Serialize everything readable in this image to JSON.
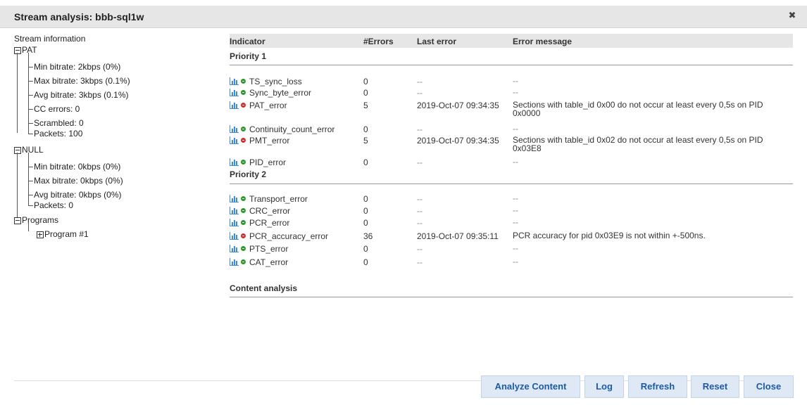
{
  "window": {
    "title": "Stream analysis: bbb-sql1w",
    "close_glyph": "✖"
  },
  "tree": {
    "root": "Stream information",
    "pat": {
      "label": "PAT",
      "items": [
        "Min bitrate: 2kbps (0%)",
        "Max bitrate: 3kbps (0.1%)",
        "Avg bitrate: 3kbps (0.1%)",
        "CC errors: 0",
        "Scrambled: 0",
        "Packets: 100"
      ]
    },
    "null": {
      "label": "NULL",
      "items": [
        "Min bitrate: 0kbps (0%)",
        "Max bitrate: 0kbps (0%)",
        "Avg bitrate: 0kbps (0%)",
        "Packets: 0"
      ]
    },
    "programs": {
      "label": "Programs",
      "items": [
        "Program #1"
      ]
    }
  },
  "table": {
    "headers": {
      "indicator": "Indicator",
      "errors": "#Errors",
      "last": "Last error",
      "message": "Error message"
    },
    "priority1": {
      "title": "Priority 1",
      "rows": [
        {
          "name": "TS_sync_loss",
          "status": "ok",
          "count": "0",
          "last": "--",
          "msg": "--"
        },
        {
          "name": "Sync_byte_error",
          "status": "ok",
          "count": "0",
          "last": "--",
          "msg": "--"
        },
        {
          "name": "PAT_error",
          "status": "err",
          "count": "5",
          "last": "2019-Oct-07 09:34:35",
          "msg": "Sections with table_id 0x00 do not occur at least every 0,5s on PID 0x0000"
        },
        {
          "name": "Continuity_count_error",
          "status": "ok",
          "count": "0",
          "last": "--",
          "msg": "--"
        },
        {
          "name": "PMT_error",
          "status": "err",
          "count": "5",
          "last": "2019-Oct-07 09:34:35",
          "msg": "Sections with table_id 0x02 do not occur at least every 0,5s on PID 0x03E8"
        },
        {
          "name": "PID_error",
          "status": "ok",
          "count": "0",
          "last": "--",
          "msg": "--"
        }
      ]
    },
    "priority2": {
      "title": "Priority 2",
      "rows": [
        {
          "name": "Transport_error",
          "status": "ok",
          "count": "0",
          "last": "--",
          "msg": "--"
        },
        {
          "name": "CRC_error",
          "status": "ok",
          "count": "0",
          "last": "--",
          "msg": "--"
        },
        {
          "name": "PCR_error",
          "status": "ok",
          "count": "0",
          "last": "--",
          "msg": "--"
        },
        {
          "name": "PCR_accuracy_error",
          "status": "err",
          "count": "36",
          "last": "2019-Oct-07 09:35:11",
          "msg": "PCR accuracy for pid 0x03E9 is not within +-500ns."
        },
        {
          "name": "PTS_error",
          "status": "ok",
          "count": "0",
          "last": "--",
          "msg": "--"
        },
        {
          "name": "CAT_error",
          "status": "ok",
          "count": "0",
          "last": "--",
          "msg": "--"
        }
      ]
    },
    "content": {
      "title": "Content analysis"
    }
  },
  "buttons": {
    "analyze": "Analyze Content",
    "log": "Log",
    "refresh": "Refresh",
    "reset": "Reset",
    "close": "Close"
  },
  "icons": {
    "chart": "bar-chart-icon",
    "status_ok": "status-ok-icon",
    "status_err": "status-error-icon",
    "expander": "tree-expander-icon",
    "close": "close-icon"
  },
  "colors": {
    "ok": "#2a9b2a",
    "error": "#d42a2a",
    "chart": "#3d8bd9",
    "button_text": "#1c5aa8",
    "button_bg": "#dfe9f5"
  }
}
